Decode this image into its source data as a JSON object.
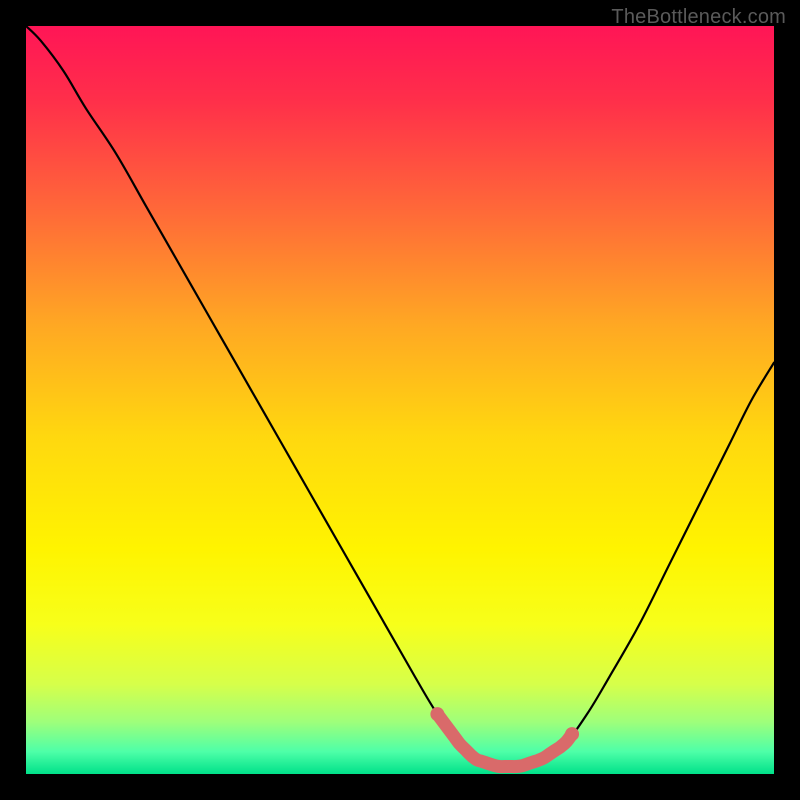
{
  "watermark": "TheBottleneck.com",
  "colors": {
    "bg": "#000000",
    "curve": "#000000",
    "highlight": "#d96a6a",
    "gradient_stops": [
      {
        "offset": 0.0,
        "color": "#ff1556"
      },
      {
        "offset": 0.1,
        "color": "#ff2f4a"
      },
      {
        "offset": 0.25,
        "color": "#ff6a38"
      },
      {
        "offset": 0.4,
        "color": "#ffa823"
      },
      {
        "offset": 0.55,
        "color": "#ffd80f"
      },
      {
        "offset": 0.7,
        "color": "#fff400"
      },
      {
        "offset": 0.8,
        "color": "#f7ff1a"
      },
      {
        "offset": 0.88,
        "color": "#d6ff4a"
      },
      {
        "offset": 0.93,
        "color": "#9fff7a"
      },
      {
        "offset": 0.97,
        "color": "#4effa8"
      },
      {
        "offset": 1.0,
        "color": "#00e18a"
      }
    ]
  },
  "chart_data": {
    "type": "line",
    "title": "",
    "xlabel": "",
    "ylabel": "",
    "xlim": [
      0,
      100
    ],
    "ylim": [
      0,
      100
    ],
    "x": [
      0,
      2,
      5,
      8,
      12,
      16,
      20,
      24,
      28,
      32,
      36,
      40,
      44,
      48,
      52,
      55,
      58,
      60,
      63,
      66,
      69,
      72,
      75,
      78,
      82,
      86,
      90,
      94,
      97,
      100
    ],
    "values": [
      100,
      98,
      94,
      89,
      83,
      76,
      69,
      62,
      55,
      48,
      41,
      34,
      27,
      20,
      13,
      8,
      4,
      2,
      1,
      1,
      2,
      4,
      8,
      13,
      20,
      28,
      36,
      44,
      50,
      55
    ],
    "highlight_x_range": [
      55,
      73
    ],
    "annotations": []
  }
}
